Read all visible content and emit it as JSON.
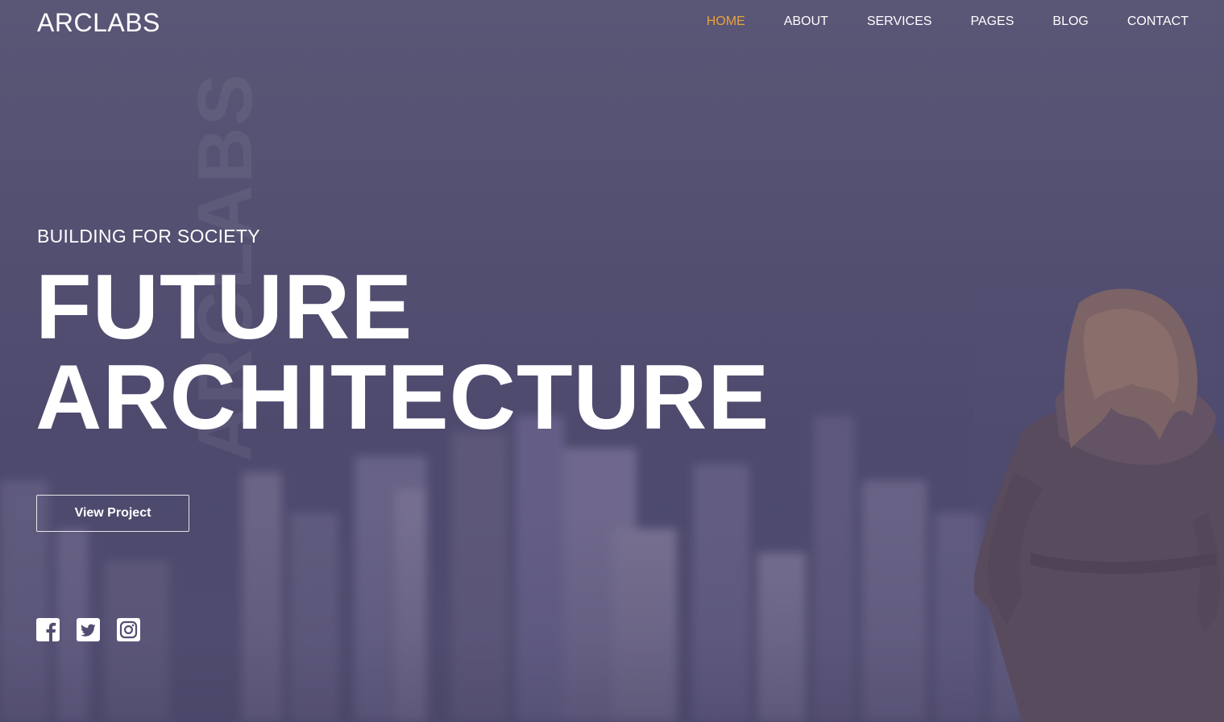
{
  "brand": {
    "logo": "ARCLABS",
    "watermark": "ARCLABS"
  },
  "nav": {
    "items": [
      {
        "label": "HOME",
        "active": true
      },
      {
        "label": "ABOUT",
        "active": false
      },
      {
        "label": "SERVICES",
        "active": false
      },
      {
        "label": "PAGES",
        "active": false
      },
      {
        "label": "BLOG",
        "active": false
      },
      {
        "label": "CONTACT",
        "active": false
      }
    ],
    "active_color": "#e8a33d"
  },
  "hero": {
    "tagline": "BUILDING FOR SOCIETY",
    "headline_line1": "FUTURE",
    "headline_line2": "ARCHITECTURE",
    "cta_label": "View Project"
  },
  "social": [
    {
      "icon": "facebook-icon"
    },
    {
      "icon": "twitter-icon"
    },
    {
      "icon": "instagram-icon"
    }
  ],
  "colors": {
    "overlay": "#524e72",
    "text": "#ffffff"
  }
}
